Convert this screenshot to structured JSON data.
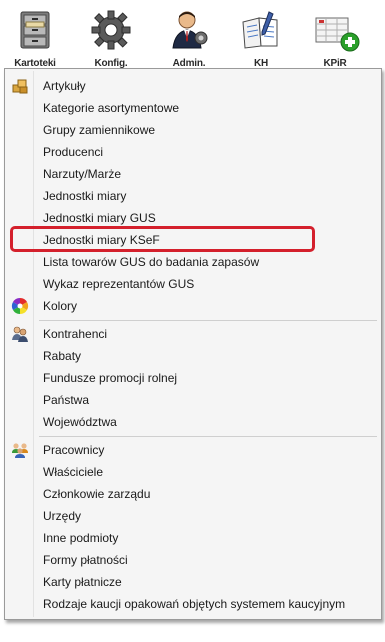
{
  "toolbar": {
    "buttons": [
      {
        "label": "Kartoteki",
        "icon": "filing-cabinet-icon"
      },
      {
        "label": "Konfig.",
        "icon": "gear-icon"
      },
      {
        "label": "Admin.",
        "icon": "admin-user-icon"
      },
      {
        "label": "KH",
        "icon": "ledger-book-icon"
      },
      {
        "label": "KPiR",
        "icon": "kpir-add-icon"
      }
    ]
  },
  "menu": {
    "group1": [
      {
        "label": "Artykuły",
        "icon": "boxes-icon"
      },
      {
        "label": "Kategorie asortymentowe"
      },
      {
        "label": "Grupy zamiennikowe"
      },
      {
        "label": "Producenci"
      },
      {
        "label": "Narzuty/Marże"
      },
      {
        "label": "Jednostki miary"
      },
      {
        "label": "Jednostki miary GUS"
      },
      {
        "label": "Jednostki miary KSeF",
        "highlighted": true
      },
      {
        "label": "Lista towarów GUS do badania zapasów"
      },
      {
        "label": "Wykaz reprezentantów GUS"
      },
      {
        "label": "Kolory",
        "icon": "color-wheel-icon"
      }
    ],
    "group2": [
      {
        "label": "Kontrahenci",
        "icon": "contractors-icon"
      },
      {
        "label": "Rabaty"
      },
      {
        "label": "Fundusze promocji rolnej"
      },
      {
        "label": "Państwa"
      },
      {
        "label": "Województwa"
      }
    ],
    "group3": [
      {
        "label": "Pracownicy",
        "icon": "employees-icon"
      },
      {
        "label": "Właściciele"
      },
      {
        "label": "Członkowie zarządu"
      },
      {
        "label": "Urzędy"
      },
      {
        "label": "Inne podmioty"
      },
      {
        "label": "Formy płatności"
      },
      {
        "label": "Karty płatnicze"
      },
      {
        "label": "Rodzaje kaucji opakowań objętych systemem kaucyjnym"
      }
    ]
  },
  "colors": {
    "highlight_border": "#d4202c",
    "menu_background": "#f5f5f5"
  }
}
